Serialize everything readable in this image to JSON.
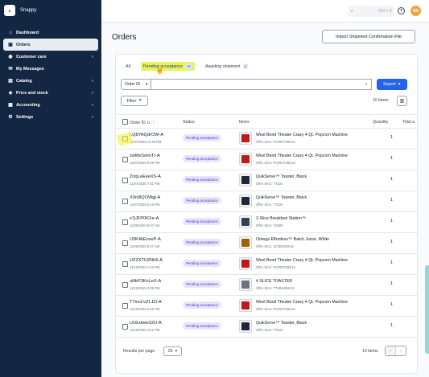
{
  "app": {
    "name": "Snappy",
    "logo_text": "Snappy"
  },
  "sidebar": {
    "items": [
      {
        "label": "Dashboard",
        "icon": "home-icon",
        "glyph": "⌂",
        "active": false,
        "has_chevron": false
      },
      {
        "label": "Orders",
        "icon": "orders-icon",
        "glyph": "▣",
        "active": true,
        "has_chevron": false
      },
      {
        "label": "Customer care",
        "icon": "customer-care-icon",
        "glyph": "◉",
        "active": false,
        "has_chevron": true
      },
      {
        "label": "My Messages",
        "icon": "messages-icon",
        "glyph": "✉",
        "active": false,
        "has_chevron": false
      },
      {
        "label": "Catalog",
        "icon": "catalog-icon",
        "glyph": "▤",
        "active": false,
        "has_chevron": true
      },
      {
        "label": "Price and stock",
        "icon": "price-tag-icon",
        "glyph": "◈",
        "active": false,
        "has_chevron": true
      },
      {
        "label": "Accounting",
        "icon": "accounting-icon",
        "glyph": "▦",
        "active": false,
        "has_chevron": true
      },
      {
        "label": "Settings",
        "icon": "gear-icon",
        "glyph": "⚙",
        "active": false,
        "has_chevron": true
      }
    ]
  },
  "topbar": {
    "search_shortcut": "Ctrl + K",
    "help": "?",
    "avatar_initials": "SN"
  },
  "page": {
    "title": "Orders",
    "import_button": "Import Shipment Confirmation File"
  },
  "tabs": [
    {
      "label": "All",
      "count": "",
      "active": false
    },
    {
      "label": "Pending acceptance",
      "count": "10",
      "active": true
    },
    {
      "label": "Awaiting shipment",
      "count": "4",
      "active": false
    }
  ],
  "filters": {
    "search_field": "Order ID",
    "search_placeholder": "",
    "export_label": "Export",
    "filter_label": "Filter",
    "items_count": "10 items"
  },
  "table": {
    "headers": {
      "order_id": "Order ID",
      "status": "Status",
      "items": "Items",
      "quantity": "Quantity",
      "total": "Total a"
    },
    "rows": [
      {
        "id": "LQ8YAQdrOW-A",
        "date": "11/07/2025 11:36 PM",
        "status": "Pending acceptance",
        "item": "West Bend Theater Crazy 4 Qt. Popcorn Machine",
        "sku": "Offer SKU: PCRBTCBK13",
        "qty": "1",
        "thumb": "#b91c1c"
      },
      {
        "id": "zwMsSoimTr-A",
        "date": "11/07/2025 8:36 PM",
        "status": "Pending acceptance",
        "item": "West Bend Theater Crazy 4 Qt. Popcorn Machine",
        "sku": "Offer SKU: PCRBTCBK13",
        "qty": "1",
        "thumb": "#b91c1c"
      },
      {
        "id": "ZnqLeEeeXS-A",
        "date": "11/07/2025 7:51 PM",
        "status": "Pending acceptance",
        "item": "QuikServe™ Toaster, Black",
        "sku": "Offer SKU: TT224",
        "qty": "1",
        "thumb": "#1f2937"
      },
      {
        "id": "X0n0lQOWgj-A",
        "date": "11/07/2025 6:19 PM",
        "status": "Pending acceptance",
        "item": "QuikServe™ Toaster, Black",
        "sku": "Offer SKU: TT224",
        "qty": "1",
        "thumb": "#1f2937"
      },
      {
        "id": "x7jJFP0KXe-A",
        "date": "11/08/2025 9:07 AM",
        "status": "Pending acceptance",
        "item": "2-Slice Breakfast Station™",
        "sku": "Offer SKU: TS500",
        "qty": "1",
        "thumb": "#374151"
      },
      {
        "id": "U3K4kEoxeP-A",
        "date": "11/08/2025 5:27 AM",
        "status": "Pending acceptance",
        "item": "Omega Effortless™ Batch Juicer, White",
        "sku": "Offer SKU: JC3022WH11",
        "qty": "1",
        "thumb": "#a16207"
      },
      {
        "id": "UZZXTU2Nh6-A",
        "date": "11/10/2025 1:42 PM",
        "status": "Pending acceptance",
        "item": "West Bend Theater Crazy 4 Qt. Popcorn Machine",
        "sku": "Offer SKU: PCRBTCBK13",
        "qty": "1",
        "thumb": "#b91c1c"
      },
      {
        "id": "uHkP3KoLeX-A",
        "date": "11/10/2025 3:06 PM",
        "status": "Pending acceptance",
        "item": "4 SLICE TOASTER",
        "sku": "Offer SKU: TT4BHSBK13",
        "qty": "1",
        "thumb": "#6b7280"
      },
      {
        "id": "T7mcLVZL1D-A",
        "date": "11/10/2025 4:32 PM",
        "status": "Pending acceptance",
        "item": "West Bend Theater Crazy 4 Qt. Popcorn Machine",
        "sku": "Offer SKU: PCRBTCBK13",
        "qty": "1",
        "thumb": "#b91c1c"
      },
      {
        "id": "U1ExtwwS2U-A",
        "date": "11/10/2025 4:21 PM",
        "status": "Pending acceptance",
        "item": "QuikServe™ Toaster, Black",
        "sku": "Offer SKU: TT224",
        "qty": "1",
        "thumb": "#1f2937"
      }
    ]
  },
  "footer": {
    "results_per_page_label": "Results per page",
    "results_per_page_value": "25",
    "items_count": "10 items",
    "prev": "‹",
    "next": "›"
  }
}
